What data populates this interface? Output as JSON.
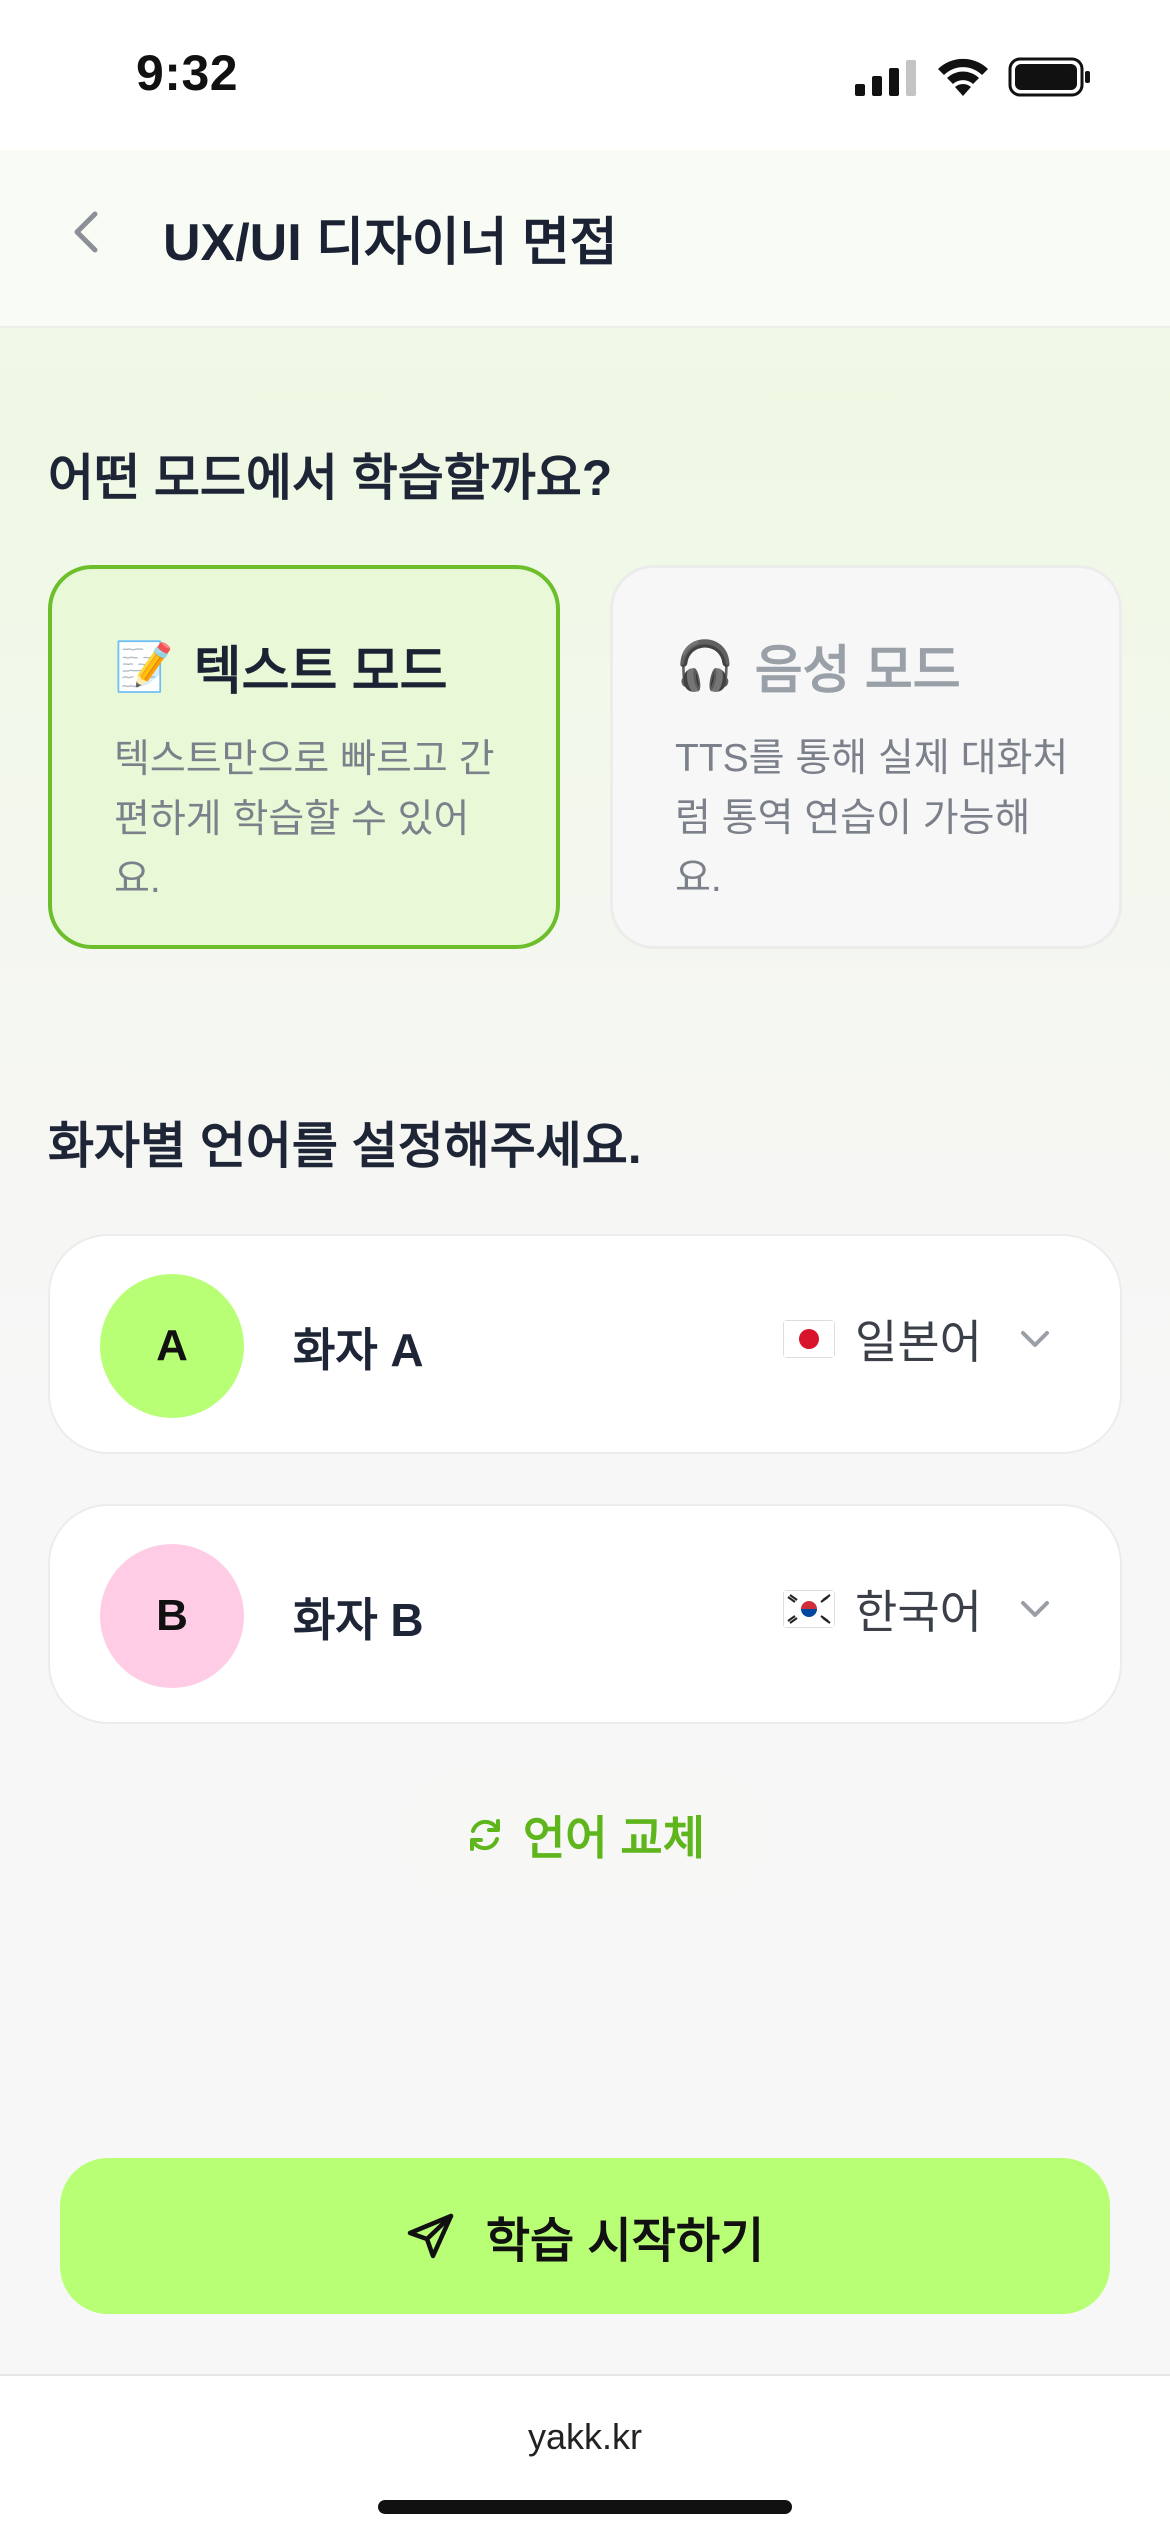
{
  "status_bar": {
    "time": "9:32"
  },
  "header": {
    "title": "UX/UI 디자이너 면접"
  },
  "mode_section": {
    "title": "어떤 모드에서 학습할까요?",
    "modes": [
      {
        "emoji": "📝",
        "title": "텍스트 모드",
        "description": "텍스트만으로 빠르고 간편하게 학습할 수 있어요.",
        "selected": true
      },
      {
        "emoji": "🎧",
        "title": "음성 모드",
        "description": "TTS를 통해 실제 대화처럼 통역 연습이 가능해요.",
        "selected": false
      }
    ]
  },
  "language_section": {
    "title": "화자별 언어를 설정해주세요.",
    "speakers": [
      {
        "initial": "A",
        "name": "화자 A",
        "language": "일본어",
        "flag": "japan-flag",
        "color": "#b8ff76"
      },
      {
        "initial": "B",
        "name": "화자 B",
        "language": "한국어",
        "flag": "korea-flag",
        "color": "#ffcce6"
      }
    ],
    "swap_label": "언어 교체"
  },
  "start_button": {
    "label": "학습 시작하기"
  },
  "browser": {
    "url": "yakk.kr"
  },
  "colors": {
    "accent": "#b8ff76",
    "accent_text": "#5fb51c",
    "selected_border": "#6cbf2a"
  }
}
